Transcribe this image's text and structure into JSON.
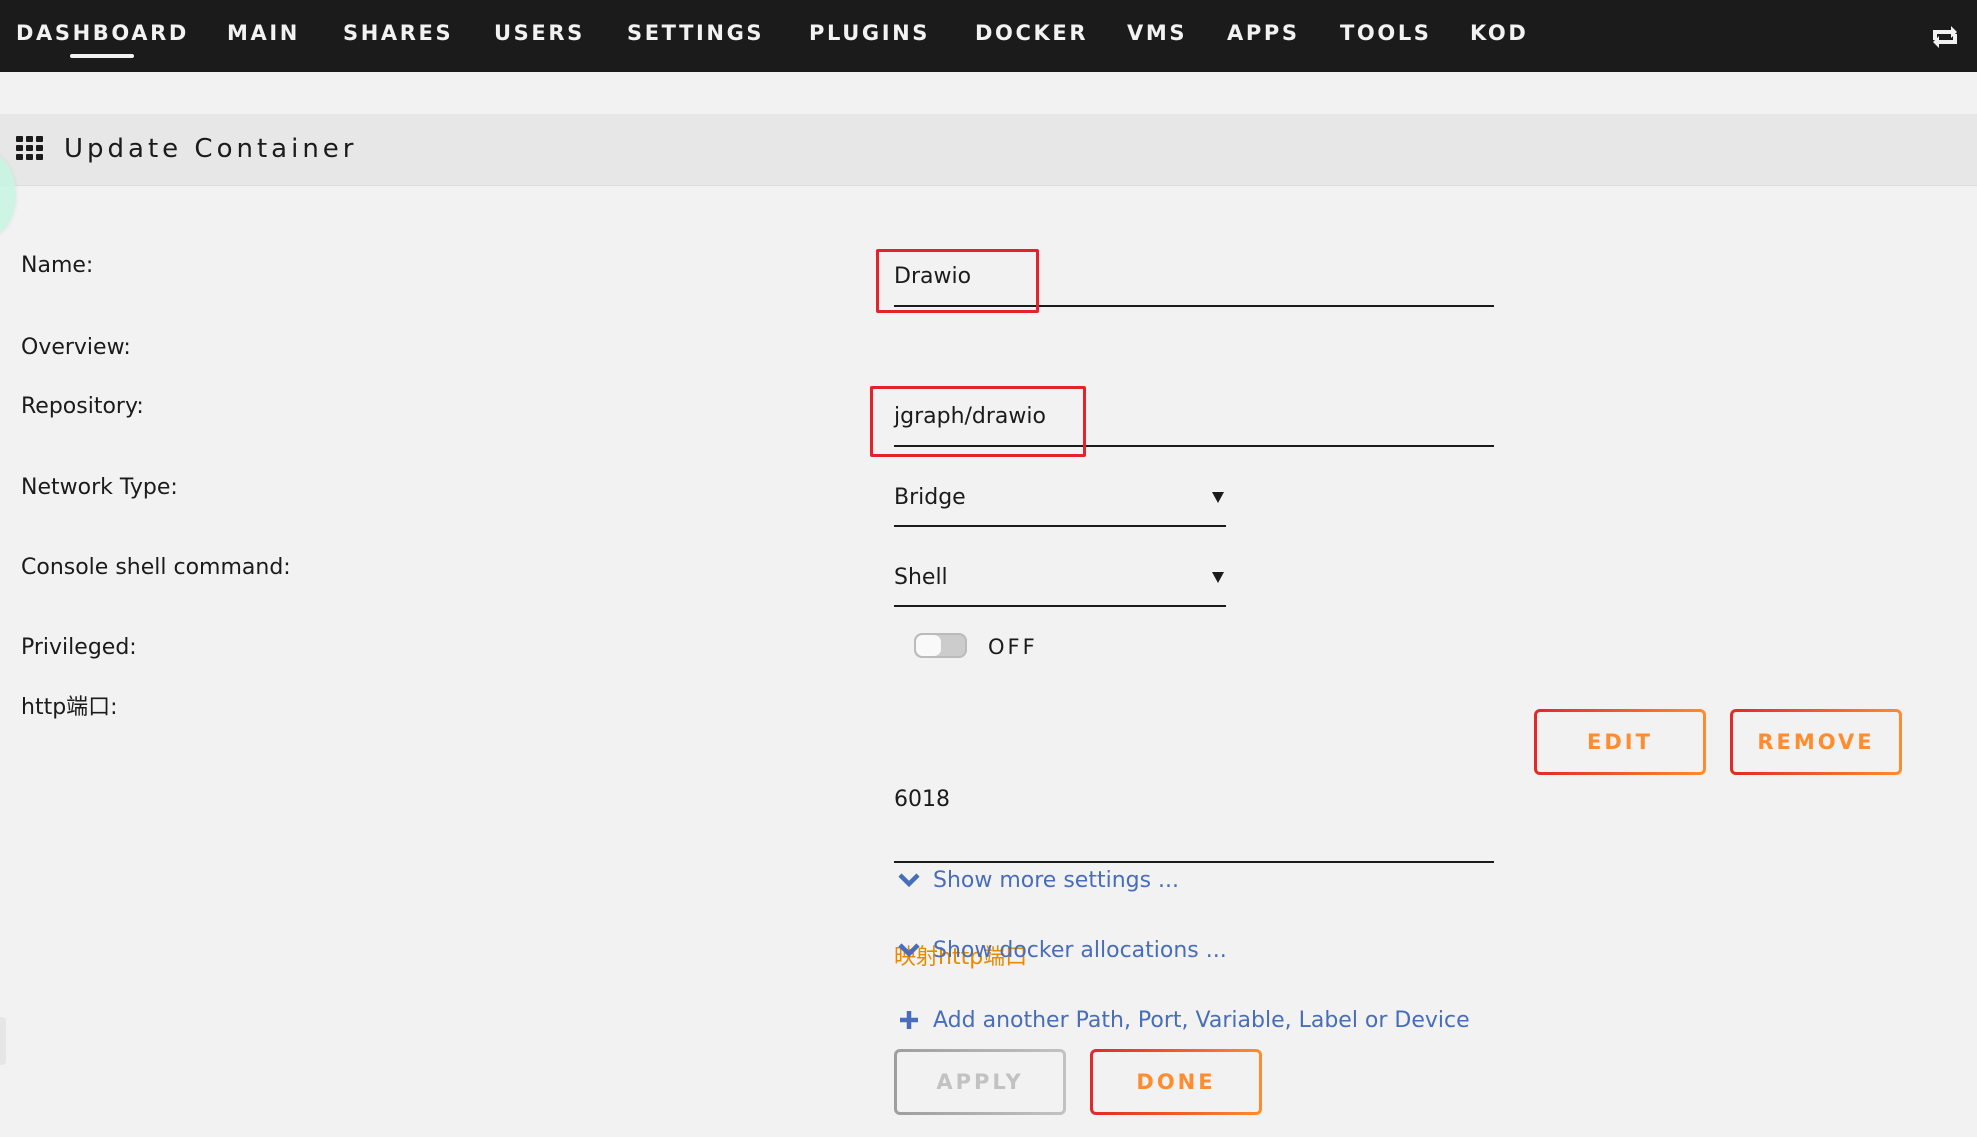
{
  "nav": {
    "items": [
      {
        "label": "DASHBOARD",
        "active": true
      },
      {
        "label": "MAIN"
      },
      {
        "label": "SHARES"
      },
      {
        "label": "USERS"
      },
      {
        "label": "SETTINGS"
      },
      {
        "label": "PLUGINS"
      },
      {
        "label": "DOCKER"
      },
      {
        "label": "VMS"
      },
      {
        "label": "APPS"
      },
      {
        "label": "TOOLS"
      },
      {
        "label": "KOD"
      }
    ],
    "right_icon": "sync-icon"
  },
  "page": {
    "title": "Update Container",
    "title_icon": "grid-icon"
  },
  "form": {
    "name": {
      "label": "Name:",
      "value": "Drawio"
    },
    "overview": {
      "label": "Overview:"
    },
    "repository": {
      "label": "Repository:",
      "value": "jgraph/drawio"
    },
    "network_type": {
      "label": "Network Type:",
      "value": "Bridge"
    },
    "console_shell": {
      "label": "Console shell command:",
      "value": "Shell"
    },
    "privileged": {
      "label": "Privileged:",
      "state": "OFF",
      "checked": false
    },
    "http_port": {
      "label": "http端口:",
      "value": "6018",
      "description": "映射http端口",
      "edit_label": "EDIT",
      "remove_label": "REMOVE"
    }
  },
  "links": {
    "show_more": "Show more settings ...",
    "show_docker": "Show docker allocations ...",
    "add_another": "Add another Path, Port, Variable, Label or Device"
  },
  "actions": {
    "apply_label": "APPLY",
    "apply_enabled": false,
    "done_label": "DONE"
  },
  "colors": {
    "nav_bg": "#1c1b1b",
    "accent_gradient_start": "#e22828",
    "accent_gradient_end": "#ff8c2f",
    "link": "#486dba",
    "hint": "#e68a00",
    "annotation": "#e5222a"
  }
}
